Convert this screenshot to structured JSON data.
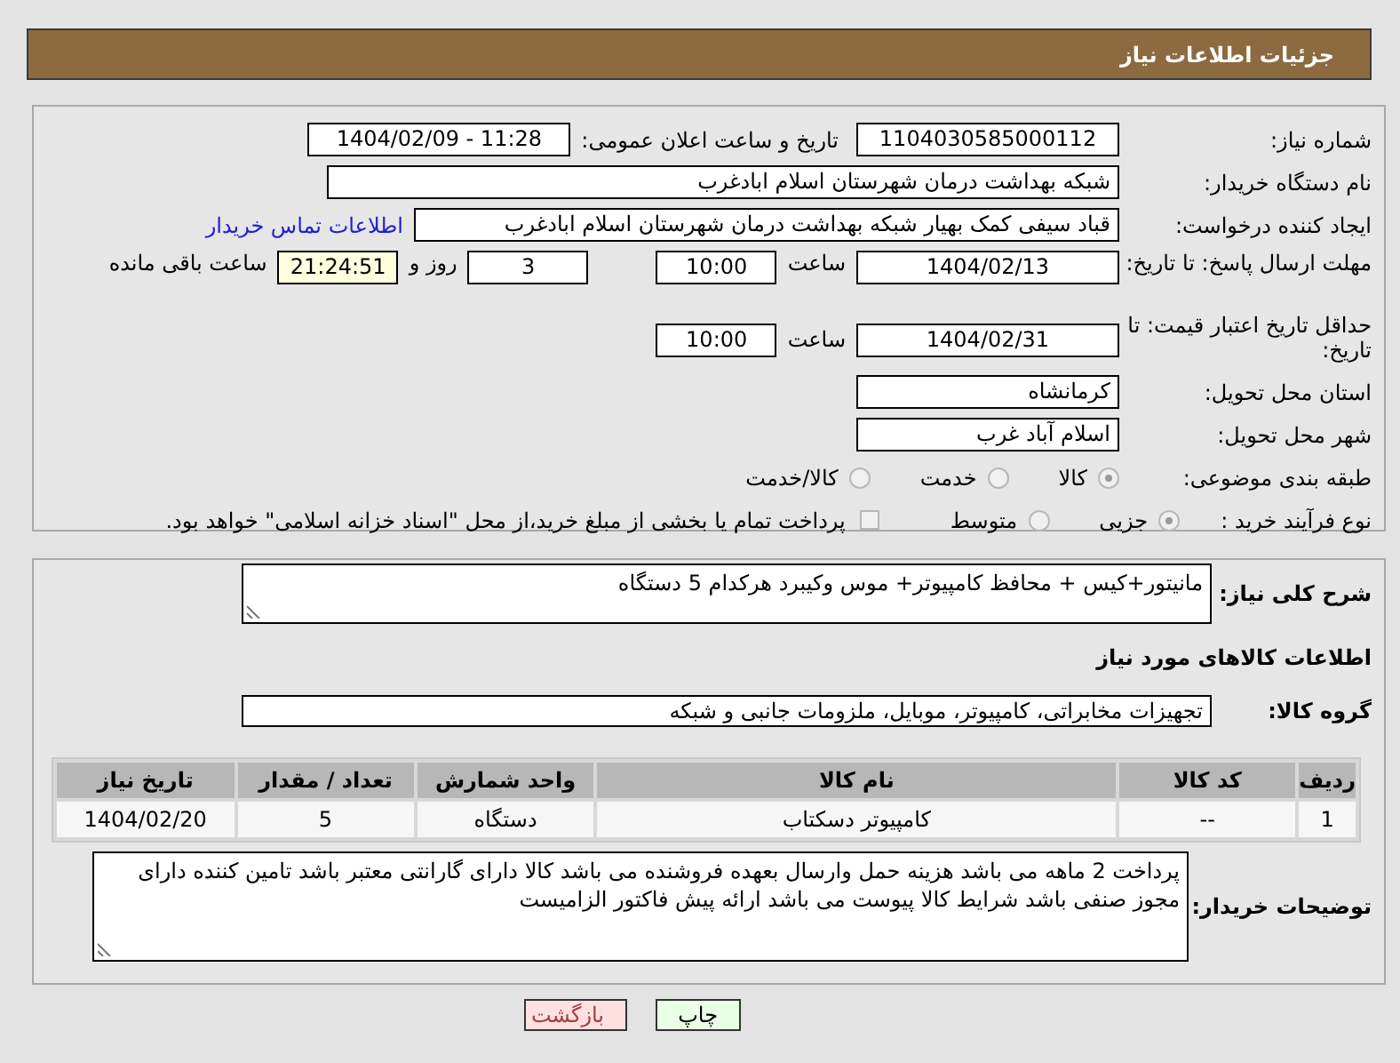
{
  "header": {
    "title": "جزئیات اطلاعات نیاز"
  },
  "details": {
    "need_number": {
      "label": "شماره نیاز:",
      "value": "1104030585000112"
    },
    "announce": {
      "label": "تاریخ و ساعت اعلان عمومی:",
      "value": "1404/02/09 - 11:28"
    },
    "buyer": {
      "label": "نام دستگاه خریدار:",
      "value": "شبکه بهداشت درمان شهرستان اسلام ابادغرب"
    },
    "creator": {
      "label": "ایجاد کننده درخواست:",
      "value": "قباد سیفی کمک بهیار شبکه بهداشت درمان شهرستان اسلام ابادغرب",
      "link": "اطلاعات تماس خریدار"
    },
    "reply_deadline": {
      "label": "مهلت ارسال پاسخ: تا تاریخ:",
      "date": "1404/02/13",
      "time_label": "ساعت",
      "time": "10:00",
      "days": "3",
      "days_label": "روز و",
      "remaining": "21:24:51",
      "remaining_label": "ساعت باقی مانده"
    },
    "price_validity": {
      "label": "حداقل تاریخ اعتبار قیمت: تا تاریخ:",
      "date": "1404/02/31",
      "time_label": "ساعت",
      "time": "10:00"
    },
    "province": {
      "label": "استان محل تحویل:",
      "value": "کرمانشاه"
    },
    "city": {
      "label": "شهر محل تحویل:",
      "value": "اسلام آباد غرب"
    },
    "category": {
      "label": "طبقه بندی موضوعی:",
      "options": [
        {
          "label": "کالا",
          "selected": true
        },
        {
          "label": "خدمت",
          "selected": false
        },
        {
          "label": "کالا/خدمت",
          "selected": false
        }
      ]
    },
    "process": {
      "label": "نوع فرآیند خرید :",
      "options": [
        {
          "label": "جزیی",
          "selected": true
        },
        {
          "label": "متوسط",
          "selected": false
        }
      ],
      "treasury": {
        "label": "پرداخت تمام یا بخشی از مبلغ خرید،از محل \"اسناد خزانه اسلامی\" خواهد بود.",
        "checked": false
      }
    }
  },
  "goods": {
    "description": {
      "label": "شرح کلی نیاز:",
      "value": "مانیتور+کیس + محافظ کامپیوتر+ موس وکیبرد هرکدام 5 دستگاه"
    },
    "section_title": "اطلاعات کالاهای مورد نیاز",
    "group": {
      "label": "گروه کالا:",
      "value": "تجهیزات مخابراتی، کامپیوتر، موبایل، ملزومات جانبی و شبکه"
    },
    "table": {
      "columns": [
        "ردیف",
        "کد کالا",
        "نام کالا",
        "واحد شمارش",
        "تعداد / مقدار",
        "تاریخ نیاز"
      ],
      "rows": [
        [
          "1",
          "--",
          "کامپیوتر دسکتاب",
          "دستگاه",
          "5",
          "1404/02/20"
        ]
      ]
    },
    "notes": {
      "label": "توضیحات خریدار:",
      "value": "پرداخت 2 ماهه می باشد   هزینه حمل وارسال بعهده فروشنده می باشد   کالا دارای گارانتی معتبر باشد  تامین کننده دارای مجوز صنفی باشد    شرایط کالا پیوست می باشد ارائه پیش فاکتور الزامیست"
    }
  },
  "buttons": [
    {
      "label": "چاپ",
      "kind": "print"
    },
    {
      "label": "بازگشت",
      "kind": "back"
    }
  ]
}
